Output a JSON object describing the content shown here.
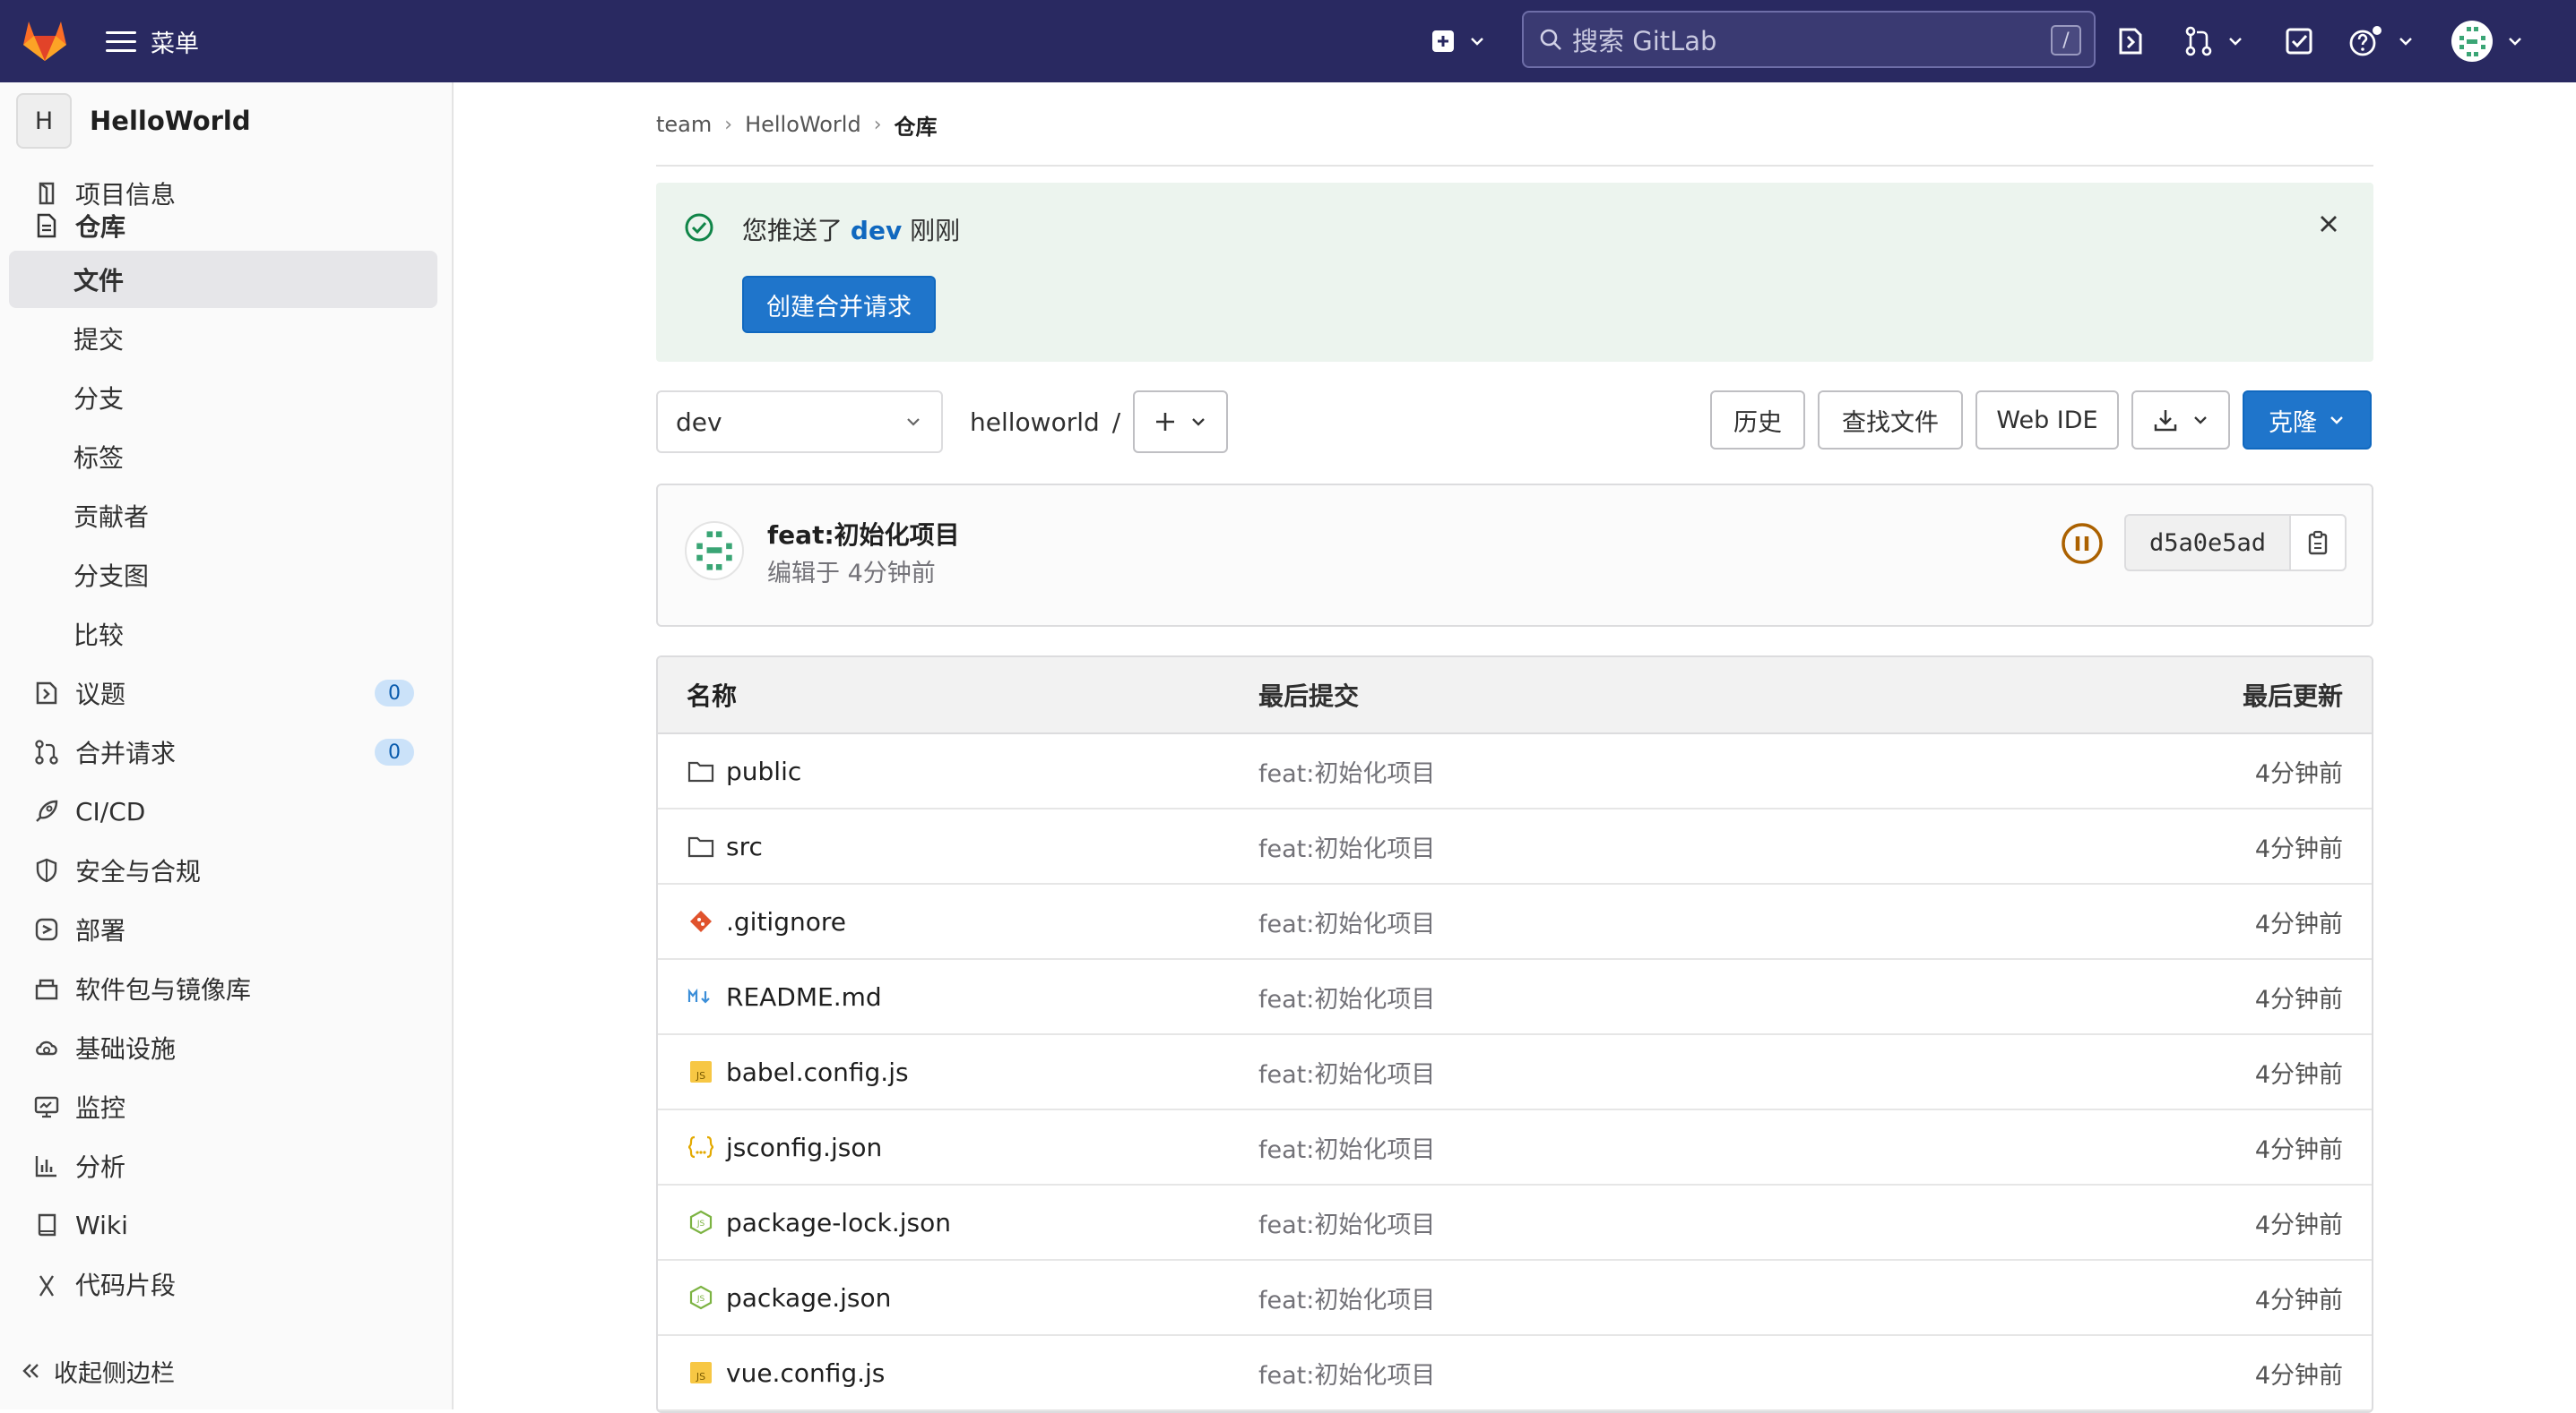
{
  "topbar": {
    "menu_label": "菜单",
    "search_placeholder": "搜索 GitLab",
    "search_shortcut": "/"
  },
  "sidebar": {
    "project_initial": "H",
    "project_name": "HelloWorld",
    "items": [
      {
        "label": "项目信息",
        "icon": "info-icon"
      },
      {
        "label": "仓库",
        "icon": "document-icon"
      },
      {
        "label": "文件"
      },
      {
        "label": "提交"
      },
      {
        "label": "分支"
      },
      {
        "label": "标签"
      },
      {
        "label": "贡献者"
      },
      {
        "label": "分支图"
      },
      {
        "label": "比较"
      },
      {
        "label": "议题",
        "icon": "issues-icon",
        "count": "0"
      },
      {
        "label": "合并请求",
        "icon": "merge-request-icon",
        "count": "0"
      },
      {
        "label": "CI/CD",
        "icon": "rocket-icon"
      },
      {
        "label": "安全与合规",
        "icon": "shield-icon"
      },
      {
        "label": "部署",
        "icon": "deploy-icon"
      },
      {
        "label": "软件包与镜像库",
        "icon": "package-icon"
      },
      {
        "label": "基础设施",
        "icon": "cloud-gear-icon"
      },
      {
        "label": "监控",
        "icon": "monitor-icon"
      },
      {
        "label": "分析",
        "icon": "chart-icon"
      },
      {
        "label": "Wiki",
        "icon": "book-icon"
      },
      {
        "label": "代码片段",
        "icon": "snippet-icon"
      }
    ],
    "collapse_label": "收起侧边栏"
  },
  "breadcrumb": [
    "team",
    "HelloWorld",
    "仓库"
  ],
  "alert": {
    "prefix": "您推送了",
    "branch": "dev",
    "suffix": "刚刚",
    "button": "创建合并请求"
  },
  "toolbar": {
    "branch": "dev",
    "path": "helloworld",
    "path_sep": "/",
    "history": "历史",
    "find_file": "查找文件",
    "web_ide": "Web IDE",
    "clone": "克隆"
  },
  "last_commit": {
    "title": "feat:初始化项目",
    "meta": "编辑于 4分钟前",
    "sha": "d5a0e5ad"
  },
  "file_table": {
    "headers": {
      "name": "名称",
      "last_commit": "最后提交",
      "last_update": "最后更新"
    },
    "rows": [
      {
        "name": "public",
        "type": "folder",
        "commit": "feat:初始化项目",
        "updated": "4分钟前"
      },
      {
        "name": "src",
        "type": "folder",
        "commit": "feat:初始化项目",
        "updated": "4分钟前"
      },
      {
        "name": ".gitignore",
        "type": "git",
        "commit": "feat:初始化项目",
        "updated": "4分钟前"
      },
      {
        "name": "README.md",
        "type": "markdown",
        "commit": "feat:初始化项目",
        "updated": "4分钟前"
      },
      {
        "name": "babel.config.js",
        "type": "js",
        "commit": "feat:初始化项目",
        "updated": "4分钟前"
      },
      {
        "name": "jsconfig.json",
        "type": "json",
        "commit": "feat:初始化项目",
        "updated": "4分钟前"
      },
      {
        "name": "package-lock.json",
        "type": "node",
        "commit": "feat:初始化项目",
        "updated": "4分钟前"
      },
      {
        "name": "package.json",
        "type": "node",
        "commit": "feat:初始化项目",
        "updated": "4分钟前"
      },
      {
        "name": "vue.config.js",
        "type": "js",
        "commit": "feat:初始化项目",
        "updated": "4分钟前"
      }
    ]
  },
  "colors": {
    "nav_bg": "#292961",
    "accent": "#1f75cb",
    "alert_bg": "#ecf4ee",
    "success": "#108548",
    "pipeline": "#ab6100"
  }
}
